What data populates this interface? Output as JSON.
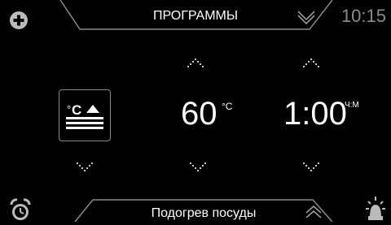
{
  "header": {
    "title": "ПРОГРАММЫ",
    "time": "10:15"
  },
  "main": {
    "mode_icon": "plate-warming-icon",
    "temperature": {
      "value": "60",
      "unit": "°C"
    },
    "duration": {
      "value": "1:00",
      "unit": "Ч:М"
    }
  },
  "footer": {
    "program_name": "Подогрев посуды"
  },
  "icons": {
    "add": "plus-circle-icon",
    "menu_toggle": "chevron-down-icon",
    "timer": "alarm-clock-icon",
    "light": "lamp-icon"
  },
  "colors": {
    "background": "#000000",
    "foreground": "#ffffff",
    "muted": "#8a8a8a"
  }
}
